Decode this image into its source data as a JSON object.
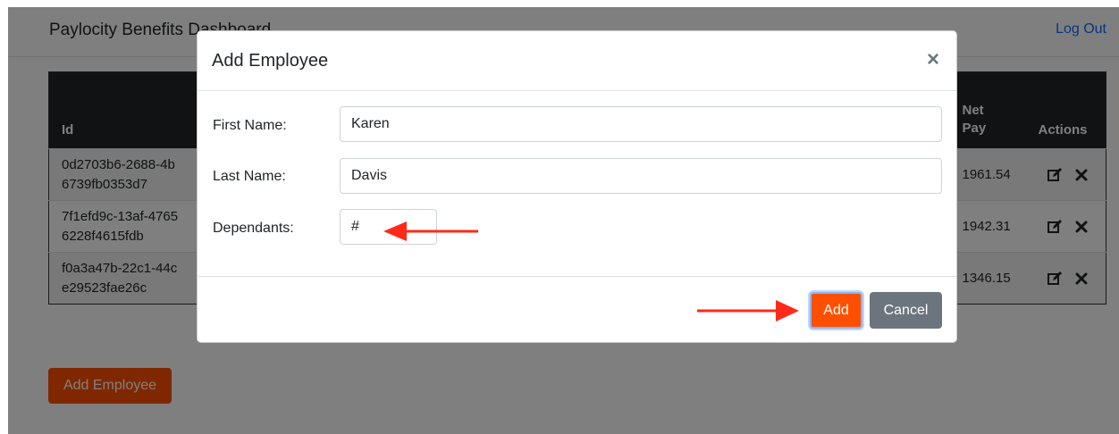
{
  "navbar": {
    "brand": "Paylocity Benefits Dashboard",
    "logout_label": "Log Out"
  },
  "table": {
    "headers": {
      "id": "Id",
      "net_pay": "Net Pay",
      "actions": "Actions"
    },
    "rows": [
      {
        "id": "0d2703b6-2688-4b... 6739fb0353d7",
        "id_line1": "0d2703b6-2688-4b",
        "id_line2": "6739fb0353d7",
        "net_pay": "1961.54"
      },
      {
        "id": "7f1efd9c-13af-4765... 6228f4615fdb",
        "id_line1": "7f1efd9c-13af-4765",
        "id_line2": "6228f4615fdb",
        "net_pay": "1942.31"
      },
      {
        "id": "f0a3a47b-22c1-44c... e29523fae26c",
        "id_line1": "f0a3a47b-22c1-44c",
        "id_line2": "e29523fae26c",
        "net_pay": "1346.15"
      }
    ],
    "edit_icon": "edit-icon",
    "delete_icon": "close-icon"
  },
  "add_employee_button": "Add Employee",
  "modal": {
    "title": "Add Employee",
    "close_glyph": "×",
    "first_name_label": "First Name:",
    "first_name_value": "Karen",
    "last_name_label": "Last Name:",
    "last_name_value": "Davis",
    "dependants_label": "Dependants:",
    "dependants_placeholder": "#",
    "add_label": "Add",
    "cancel_label": "Cancel"
  },
  "colors": {
    "accent": "#fe5000",
    "annotation_arrow": "#ff2a1a",
    "link": "#0d6efd",
    "table_header": "#212529",
    "secondary": "#6c757d"
  }
}
